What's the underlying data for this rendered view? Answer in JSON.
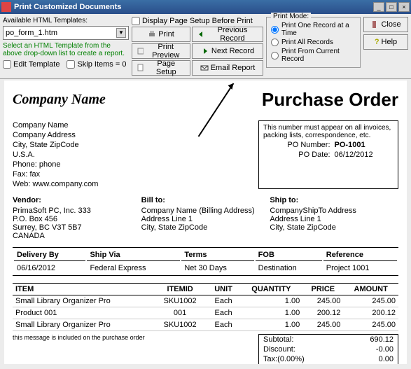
{
  "window": {
    "title": "Print Customized Documents",
    "minimize": "_",
    "maximize": "□",
    "close": "×"
  },
  "toolbar": {
    "templates_label": "Available HTML Templates:",
    "template_selected": "po_form_1.htm",
    "hint": "Select an HTML Template from the above drop-down list to create a report.",
    "edit_template": "Edit Template",
    "skip_items": "Skip Items = 0",
    "display_setup": "Display Page Setup Before Print",
    "print": "Print",
    "print_preview": "Print Preview",
    "page_setup": "Page Setup",
    "previous": "Previous Record",
    "next": "Next Record",
    "email": "Email Report",
    "print_mode": "Print Mode:",
    "mode_one": "Print One Record at a Time",
    "mode_all": "Print All Records",
    "mode_from": "Print From Current Record",
    "close_btn": "Close",
    "help_btn": "Help"
  },
  "doc": {
    "company_italic": "Company Name",
    "title": "Purchase Order",
    "company_info": {
      "name": "Company Name",
      "address": "Company Address",
      "csz": "City, State ZipCode",
      "country": "U.S.A.",
      "phone": "Phone: phone",
      "fax": "Fax: fax",
      "web": "Web: www.company.com"
    },
    "po_box": {
      "note": "This number must appear on all invoices, packing lists, correspondence, etc.",
      "po_number_label": "PO Number:",
      "po_number": "PO-1001",
      "po_date_label": "PO Date:",
      "po_date": "06/12/2012"
    },
    "vendor": {
      "h": "Vendor:",
      "l1": "PrimaSoft PC, Inc. 333",
      "l2": "P.O. Box 456",
      "l3": "Surrey, BC V3T 5B7",
      "l4": "CANADA"
    },
    "billto": {
      "h": "Bill to:",
      "l1": "Company Name (Billing Address)",
      "l2": "Address Line 1",
      "l3": "City, State ZipCode"
    },
    "shipto": {
      "h": "Ship to:",
      "l1": "CompanyShipTo Address",
      "l2": "Address Line 1",
      "l3": "City, State ZipCode"
    },
    "ship_headers": [
      "Delivery By",
      "Ship Via",
      "Terms",
      "FOB",
      "Reference"
    ],
    "ship_row": [
      "06/16/2012",
      "Federal Express",
      "Net 30 Days",
      "Destination",
      "Project 1001"
    ],
    "item_headers": [
      "ITEM",
      "ITEMID",
      "UNIT",
      "QUANTITY",
      "PRICE",
      "AMOUNT"
    ],
    "items": [
      {
        "item": "Small Library Organizer Pro",
        "id": "SKU1002",
        "unit": "Each",
        "qty": "1.00",
        "price": "245.00",
        "amount": "245.00"
      },
      {
        "item": "Product 001",
        "id": "001",
        "unit": "Each",
        "qty": "1.00",
        "price": "200.12",
        "amount": "200.12"
      },
      {
        "item": "Small Library Organizer Pro",
        "id": "SKU1002",
        "unit": "Each",
        "qty": "1.00",
        "price": "245.00",
        "amount": "245.00"
      }
    ],
    "message": "this message is included on the purchase order",
    "totals": {
      "subtotal_l": "Subtotal:",
      "subtotal": "690.12",
      "discount_l": "Discount:",
      "discount": "-0.00",
      "tax_l": "Tax:(0.00%)",
      "tax": "0.00"
    }
  }
}
